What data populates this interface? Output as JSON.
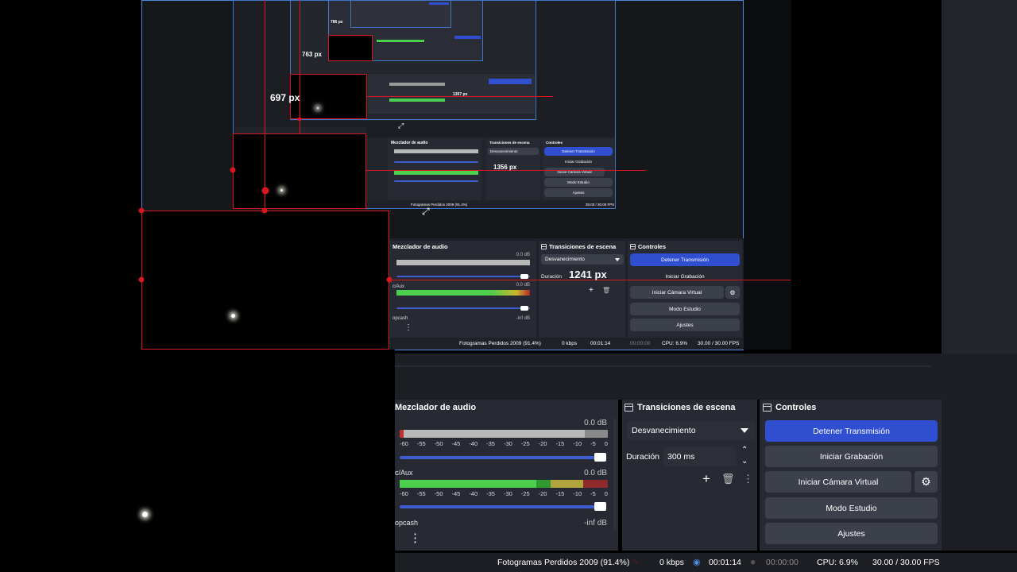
{
  "docks": {
    "mixer_title": "Mezclador de audio",
    "transitions_title": "Transiciones de escena",
    "controls_title": "Controles"
  },
  "mixer": {
    "channels": [
      {
        "name": "",
        "db": "0.0 dB"
      },
      {
        "name": "c/Aux",
        "db": "0.0 dB"
      },
      {
        "name": "opcash",
        "db": "-inf dB"
      }
    ],
    "scale": [
      "-60",
      "-55",
      "-50",
      "-45",
      "-40",
      "-35",
      "-30",
      "-25",
      "-20",
      "-15",
      "-10",
      "-5",
      "0"
    ]
  },
  "transitions": {
    "selected": "Desvanecimiento",
    "duration_label": "Duración",
    "duration_value": "300 ms"
  },
  "controls": {
    "stop_stream": "Detener Transmisión",
    "start_recording": "Iniciar Grabación",
    "start_virtual_cam": "Iniciar Cámara Virtual",
    "studio_mode": "Modo Estudio",
    "settings": "Ajustes"
  },
  "statusbar": {
    "dropped_frames": "Fotogramas Perdidos 2009 (91.4%)",
    "kbps": "0 kbps",
    "stream_time": "00:01:14",
    "rec_time": "00:00:00",
    "cpu": "CPU: 6.9%",
    "fps": "30.00 / 30.00 FPS"
  },
  "overlays": {
    "px_1241": "1241 px",
    "px_1356": "1356 px",
    "px_1397": "1397 px",
    "px_697": "697 px",
    "px_763": "763 px",
    "px_786": "786 px"
  },
  "colors": {
    "accent_blue": "#2f4fd0",
    "measure_red": "#d8161f",
    "dock_bg": "#272a33",
    "button_bg": "#3c404b",
    "meter_green": "#4ccf4c",
    "meter_gray": "#b9b9b9"
  }
}
